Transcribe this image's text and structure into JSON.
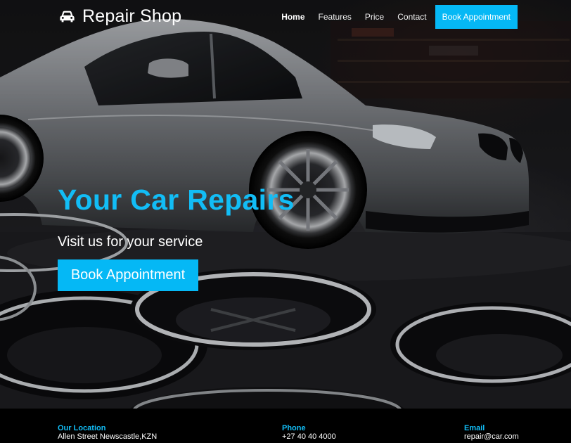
{
  "brand": {
    "name": "Repair Shop",
    "icon": "car-icon"
  },
  "nav": {
    "items": [
      "Home",
      "Features",
      "Price",
      "Contact"
    ],
    "active": "Home",
    "cta_label": "Book Appointment"
  },
  "hero": {
    "title": "Your Car Repairs",
    "subtitle": "Visit us for your service",
    "button_label": "Book Appointment",
    "background": "photo of a silver car in a workshop with chrome wheel rims on the floor"
  },
  "footer": {
    "location": {
      "label": "Our Location",
      "value": "Allen Street Newscastle,KZN"
    },
    "phone": {
      "label": "Phone",
      "value": "+27 40 40 4000"
    },
    "email": {
      "label": "Email",
      "value": "repair@car.com"
    }
  },
  "colors": {
    "accent": "#05b8f5",
    "title": "#12bdf6",
    "footer_bg": "#000000",
    "text": "#ffffff"
  }
}
